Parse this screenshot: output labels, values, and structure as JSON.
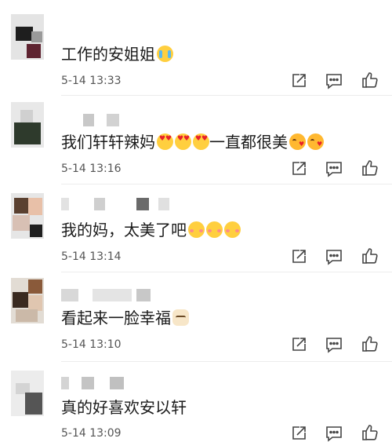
{
  "comments": [
    {
      "text": "工作的安姐姐",
      "emojis": [
        "crying"
      ],
      "time": "5-14 13:33"
    },
    {
      "text_before": "我们轩轩辣妈",
      "emojis_mid": [
        "heart",
        "heart",
        "heart"
      ],
      "text_after": "一直都很美",
      "emojis_end": [
        "kiss",
        "kiss"
      ],
      "time": "5-14 13:16"
    },
    {
      "text": "我的妈，太美了吧",
      "emojis": [
        "blush",
        "blush",
        "blush"
      ],
      "time": "5-14 13:14"
    },
    {
      "text": "看起来一脸幸福",
      "emojis": [
        "cat"
      ],
      "time": "5-14 13:10"
    },
    {
      "text": "真的好喜欢安以轩",
      "emojis": [],
      "time": "5-14 13:09"
    }
  ],
  "actions": [
    "share-icon",
    "reply-icon",
    "like-icon"
  ],
  "colors": {
    "icon": "#444444",
    "divider": "#ececec",
    "time": "#555555"
  }
}
